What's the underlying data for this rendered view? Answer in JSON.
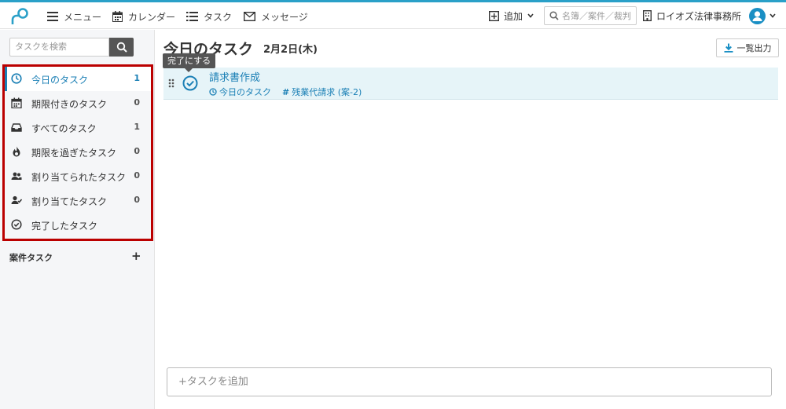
{
  "header": {
    "nav": [
      {
        "label": "メニュー",
        "icon": "menu-icon"
      },
      {
        "label": "カレンダー",
        "icon": "calendar-icon"
      },
      {
        "label": "タスク",
        "icon": "list-icon"
      },
      {
        "label": "メッセージ",
        "icon": "mail-icon"
      }
    ],
    "add_label": "追加",
    "search_placeholder": "名簿／案件／裁判",
    "firm_name": "ロイオズ法律事務所",
    "accent_color": "#2aa0c8"
  },
  "sidebar": {
    "search_placeholder": "タスクを検索",
    "items": [
      {
        "label": "今日のタスク",
        "count": "1",
        "icon": "clock-icon"
      },
      {
        "label": "期限付きのタスク",
        "count": "0",
        "icon": "calendar-icon"
      },
      {
        "label": "すべてのタスク",
        "count": "1",
        "icon": "inbox-icon"
      },
      {
        "label": "期限を過ぎたタスク",
        "count": "0",
        "icon": "fire-icon"
      },
      {
        "label": "割り当てられたタスク",
        "count": "0",
        "icon": "users-icon"
      },
      {
        "label": "割り当てたタスク",
        "count": "0",
        "icon": "user-check-icon"
      },
      {
        "label": "完了したタスク",
        "count": "",
        "icon": "check-circle-icon"
      }
    ],
    "case_tasks_label": "案件タスク",
    "case_tasks_add": "+"
  },
  "main": {
    "title": "今日のタスク",
    "date": "2月2日(木)",
    "export_label": "一覧出力",
    "tooltip": "完了にする",
    "task": {
      "name": "請求書作成",
      "tag1": "今日のタスク",
      "tag2": "残業代請求 (案-2)"
    },
    "add_task_placeholder": "+タスクを追加"
  }
}
